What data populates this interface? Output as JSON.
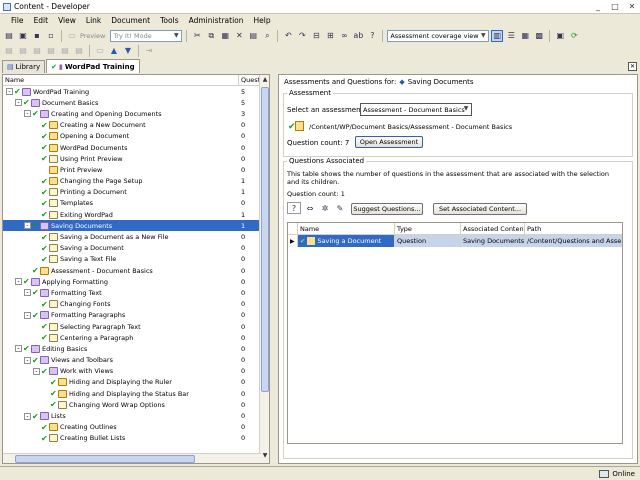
{
  "window": {
    "title": "Content - Developer",
    "controls": [
      "_",
      "□",
      "✕"
    ]
  },
  "menu": [
    "File",
    "Edit",
    "View",
    "Link",
    "Document",
    "Tools",
    "Administration",
    "Help"
  ],
  "toolbar": {
    "preview_label": "Preview",
    "mode_value": "Try It! Mode",
    "view_value": "Assessment coverage view"
  },
  "tabs": [
    {
      "label": "Library",
      "active": false
    },
    {
      "label": "WordPad Training",
      "active": true
    }
  ],
  "tree": {
    "col_name": "Name",
    "col_questions": "Questions",
    "rows": [
      {
        "level": 0,
        "exp": "-",
        "check": true,
        "icon": "book",
        "label": "WordPad Training",
        "count": "5"
      },
      {
        "level": 1,
        "exp": "-",
        "check": true,
        "icon": "book",
        "label": "Document Basics",
        "count": "5"
      },
      {
        "level": 2,
        "exp": "-",
        "check": true,
        "icon": "book",
        "label": "Creating and Opening Documents",
        "count": "3"
      },
      {
        "level": 3,
        "exp": "",
        "check": true,
        "icon": "ques",
        "label": "Creating a New Document",
        "count": "0"
      },
      {
        "level": 3,
        "exp": "",
        "check": true,
        "icon": "ques",
        "label": "Opening a Document",
        "count": "0"
      },
      {
        "level": 3,
        "exp": "",
        "check": true,
        "icon": "ques",
        "label": "WordPad Documents",
        "count": "0"
      },
      {
        "level": 3,
        "exp": "",
        "check": true,
        "icon": "doc",
        "label": "Using Print Preview",
        "count": "0"
      },
      {
        "level": 3,
        "exp": "",
        "check": false,
        "icon": "ques",
        "label": "Print Preview",
        "count": "0"
      },
      {
        "level": 3,
        "exp": "",
        "check": true,
        "icon": "ques",
        "label": "Changing the Page Setup",
        "count": "1"
      },
      {
        "level": 3,
        "exp": "",
        "check": true,
        "icon": "doc",
        "label": "Printing a Document",
        "count": "1"
      },
      {
        "level": 3,
        "exp": "",
        "check": true,
        "icon": "doc",
        "label": "Templates",
        "count": "0"
      },
      {
        "level": 3,
        "exp": "",
        "check": true,
        "icon": "doc",
        "label": "Exiting WordPad",
        "count": "1"
      },
      {
        "level": 2,
        "exp": "-",
        "check": true,
        "icon": "book",
        "label": "Saving Documents",
        "count": "1",
        "selected": true
      },
      {
        "level": 3,
        "exp": "",
        "check": true,
        "icon": "doc",
        "label": "Saving a Document as a New File",
        "count": "0"
      },
      {
        "level": 3,
        "exp": "",
        "check": true,
        "icon": "doc",
        "label": "Saving a Document",
        "count": "0"
      },
      {
        "level": 3,
        "exp": "",
        "check": true,
        "icon": "doc",
        "label": "Saving a Text File",
        "count": "0"
      },
      {
        "level": 2,
        "exp": "",
        "check": true,
        "icon": "ques",
        "label": "Assessment - Document Basics",
        "count": "0"
      },
      {
        "level": 1,
        "exp": "-",
        "check": true,
        "icon": "book",
        "label": "Applying Formatting",
        "count": "0"
      },
      {
        "level": 2,
        "exp": "-",
        "check": true,
        "icon": "book",
        "label": "Formatting Text",
        "count": "0"
      },
      {
        "level": 3,
        "exp": "",
        "check": true,
        "icon": "doc",
        "label": "Changing Fonts",
        "count": "0"
      },
      {
        "level": 2,
        "exp": "-",
        "check": true,
        "icon": "book",
        "label": "Formatting Paragraphs",
        "count": "0"
      },
      {
        "level": 3,
        "exp": "",
        "check": true,
        "icon": "doc",
        "label": "Selecting Paragraph Text",
        "count": "0"
      },
      {
        "level": 3,
        "exp": "",
        "check": true,
        "icon": "doc",
        "label": "Centering a Paragraph",
        "count": "0"
      },
      {
        "level": 1,
        "exp": "-",
        "check": true,
        "icon": "book",
        "label": "Editing Basics",
        "count": "0"
      },
      {
        "level": 2,
        "exp": "-",
        "check": true,
        "icon": "book",
        "label": "Views and Toolbars",
        "count": "0"
      },
      {
        "level": 3,
        "exp": "-",
        "check": true,
        "icon": "book",
        "label": "Work with Views",
        "count": "0"
      },
      {
        "level": 4,
        "exp": "",
        "check": true,
        "icon": "ques",
        "label": "Hiding and Displaying the Ruler",
        "count": "0"
      },
      {
        "level": 4,
        "exp": "",
        "check": true,
        "icon": "ques",
        "label": "Hiding and Displaying the Status Bar",
        "count": "0"
      },
      {
        "level": 4,
        "exp": "",
        "check": true,
        "icon": "doc",
        "label": "Changing Word Wrap Options",
        "count": "0"
      },
      {
        "level": 2,
        "exp": "-",
        "check": true,
        "icon": "book",
        "label": "Lists",
        "count": "0"
      },
      {
        "level": 3,
        "exp": "",
        "check": true,
        "icon": "ques",
        "label": "Creating Outlines",
        "count": "0"
      },
      {
        "level": 3,
        "exp": "",
        "check": true,
        "icon": "doc",
        "label": "Creating Bullet Lists",
        "count": "0"
      }
    ]
  },
  "right": {
    "heading_prefix": "Assessments and Questions for:",
    "heading_item": "Saving Documents",
    "assessment": {
      "group_title": "Assessment",
      "select_label": "Select an assessment:",
      "select_value": "Assessment - Document Basics",
      "path": "/Content/WP/Document Basics/Assessment - Document Basics",
      "count_label": "Question count: 7",
      "open_button": "Open Assessment"
    },
    "questions": {
      "group_title": "Questions Associated",
      "description": "This table shows the number of questions in the assessment that are associated with the selection and its children.",
      "count_label": "Question count: 1",
      "suggest_button": "Suggest Questions...",
      "set_button": "Set Associated Content...",
      "columns": [
        "Name",
        "Type",
        "Associated Content",
        "Path"
      ],
      "rows": [
        {
          "name": "Saving a Document",
          "type": "Question",
          "content": "Saving Documents",
          "path": "/Content/Questions and Asse..."
        }
      ]
    }
  },
  "status": {
    "text": "Online"
  }
}
